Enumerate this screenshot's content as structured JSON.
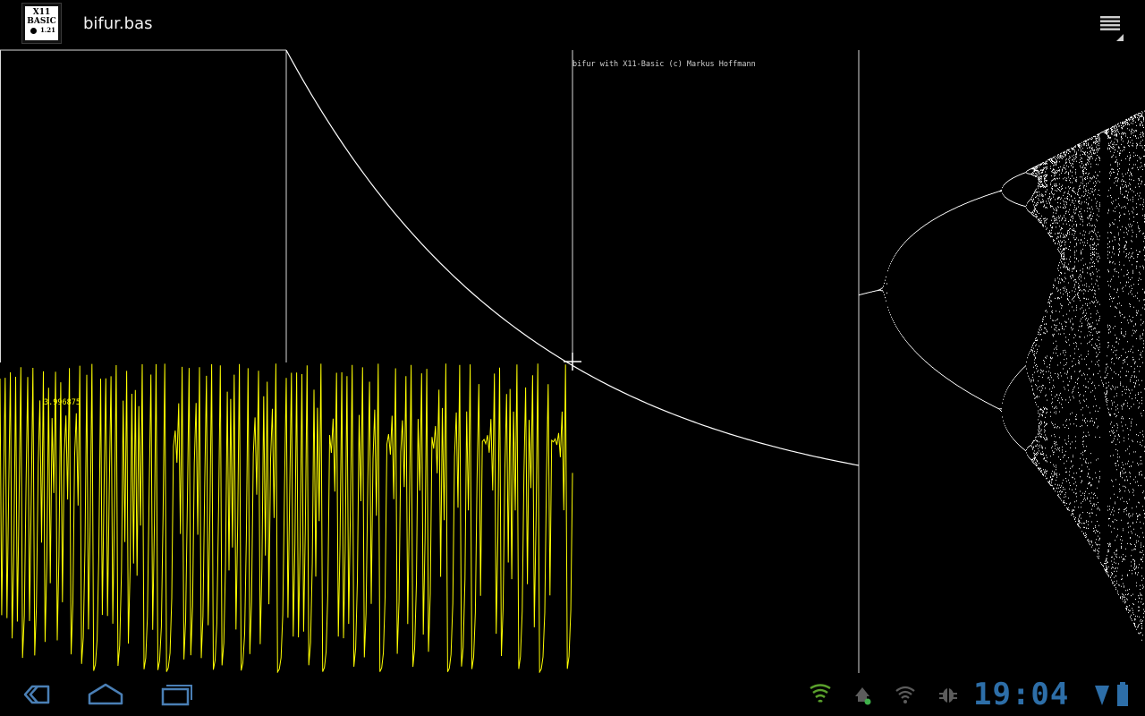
{
  "app": {
    "title": "bifur.bas",
    "icon": {
      "name": "x11-basic-icon",
      "lines": [
        "X11",
        "BASIC",
        "1.21"
      ]
    },
    "menu_icon": "overflow-menu-icon"
  },
  "canvas": {
    "caption": "bifur with X11-Basic (c) Markus Hoffmann",
    "readout_value": "3.996875",
    "colors": {
      "background": "#000000",
      "frame": "#d9d9d9",
      "curve": "#ffffff",
      "iteration_trace": "#ffff00",
      "bifurcation": "#ffffff"
    }
  },
  "system_bar": {
    "nav": [
      "back-icon",
      "home-icon",
      "recent-apps-icon"
    ],
    "status_icons": [
      "shield-icon",
      "usb-debug-icon",
      "wifi-icon",
      "android-debug-icon",
      "battery-icon"
    ],
    "clock": "19:04",
    "accent_color": "#2d6ea8"
  }
}
